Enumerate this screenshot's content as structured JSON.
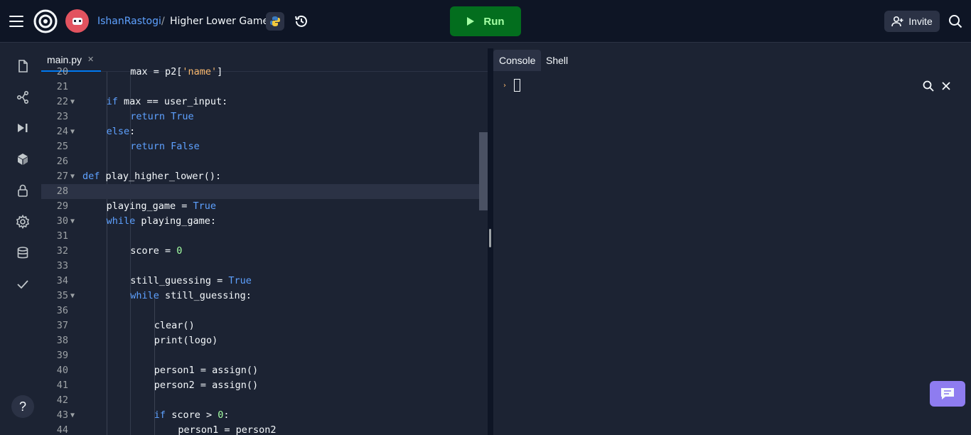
{
  "topbar": {
    "user": "IshanRastogi",
    "separator": "/",
    "repo": "Higher Lower Game",
    "run_label": "Run",
    "invite_label": "Invite"
  },
  "sidebar": {
    "items": [
      "files-icon",
      "git-icon",
      "debugger-icon",
      "packages-icon",
      "secrets-icon",
      "settings-icon",
      "database-icon",
      "unit-tests-icon"
    ],
    "help_label": "?"
  },
  "editor": {
    "tab": "main.py",
    "lines": [
      {
        "n": "20",
        "fold": false,
        "indent": 2,
        "html": "max = p2[<span class=\"str\">'name'</span>]"
      },
      {
        "n": "21",
        "fold": false,
        "indent": 0,
        "html": ""
      },
      {
        "n": "22",
        "fold": true,
        "indent": 1,
        "html": "<span class=\"kw\">if</span> max == user_input:"
      },
      {
        "n": "23",
        "fold": false,
        "indent": 2,
        "html": "<span class=\"kw\">return</span> <span class=\"kw\">True</span>"
      },
      {
        "n": "24",
        "fold": true,
        "indent": 1,
        "html": "<span class=\"kw\">else</span>:"
      },
      {
        "n": "25",
        "fold": false,
        "indent": 2,
        "html": "<span class=\"kw\">return</span> <span class=\"kw\">False</span>"
      },
      {
        "n": "26",
        "fold": false,
        "indent": 0,
        "html": ""
      },
      {
        "n": "27",
        "fold": true,
        "indent": 0,
        "html": "<span class=\"kw\">def</span> play_higher_lower():"
      },
      {
        "n": "28",
        "fold": false,
        "indent": 0,
        "html": "",
        "active": true
      },
      {
        "n": "29",
        "fold": false,
        "indent": 1,
        "html": "playing_game = <span class=\"kw\">True</span>"
      },
      {
        "n": "30",
        "fold": true,
        "indent": 1,
        "html": "<span class=\"kw\">while</span> playing_game:"
      },
      {
        "n": "31",
        "fold": false,
        "indent": 0,
        "html": ""
      },
      {
        "n": "32",
        "fold": false,
        "indent": 2,
        "html": "score = <span class=\"num\">0</span>"
      },
      {
        "n": "33",
        "fold": false,
        "indent": 0,
        "html": ""
      },
      {
        "n": "34",
        "fold": false,
        "indent": 2,
        "html": "still_guessing = <span class=\"kw\">True</span>"
      },
      {
        "n": "35",
        "fold": true,
        "indent": 2,
        "html": "<span class=\"kw\">while</span> still_guessing:"
      },
      {
        "n": "36",
        "fold": false,
        "indent": 0,
        "html": ""
      },
      {
        "n": "37",
        "fold": false,
        "indent": 3,
        "html": "clear()"
      },
      {
        "n": "38",
        "fold": false,
        "indent": 3,
        "html": "print(logo)"
      },
      {
        "n": "39",
        "fold": false,
        "indent": 0,
        "html": ""
      },
      {
        "n": "40",
        "fold": false,
        "indent": 3,
        "html": "person1 = assign()"
      },
      {
        "n": "41",
        "fold": false,
        "indent": 3,
        "html": "person2 = assign()"
      },
      {
        "n": "42",
        "fold": false,
        "indent": 0,
        "html": ""
      },
      {
        "n": "43",
        "fold": true,
        "indent": 3,
        "html": "<span class=\"kw\">if</span> score &gt; <span class=\"num\">0</span>:"
      },
      {
        "n": "44",
        "fold": false,
        "indent": 4,
        "html": "person1 = person2"
      }
    ]
  },
  "console": {
    "tabs": [
      "Console",
      "Shell"
    ],
    "active_tab": "Console"
  },
  "colors": {
    "background": "#1c2333",
    "topbar": "#0e1525",
    "run_button": "#036e1e",
    "keyword": "#5ea1ff",
    "number": "#a4ffa4",
    "string": "#fbb96e",
    "chat_button": "#8e7cf0"
  }
}
